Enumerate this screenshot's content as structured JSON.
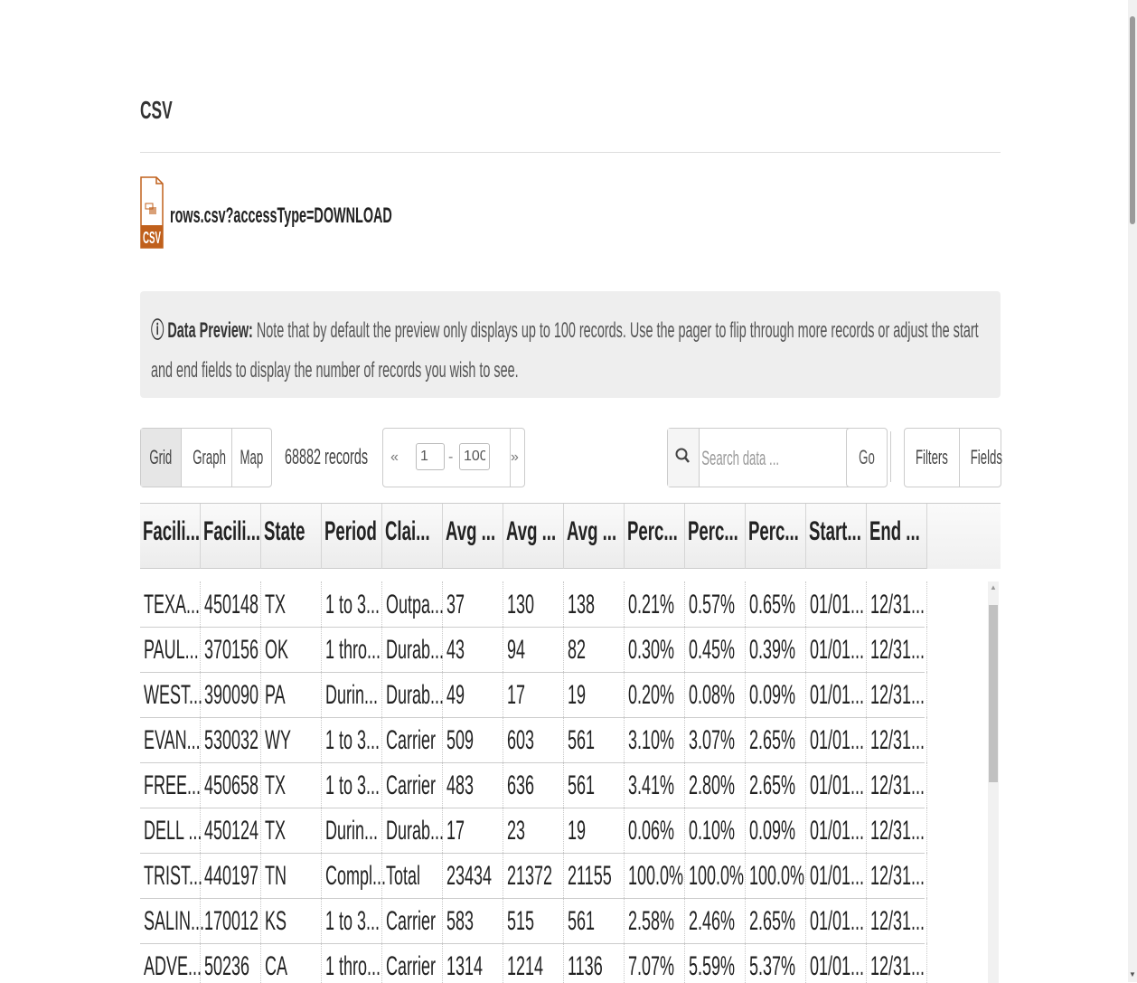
{
  "section_title": "CSV",
  "file": {
    "icon_label": "CSV",
    "name": "rows.csv?accessType=DOWNLOAD"
  },
  "notice": {
    "label": "Data Preview:",
    "text": "Note that by default the preview only displays up to 100 records. Use the pager to flip through more records or adjust the start and end fields to display the number of records you wish to see."
  },
  "toolbar": {
    "view_tabs": [
      "Grid",
      "Graph",
      "Map"
    ],
    "records": "68882 records",
    "pager": {
      "prev": "«",
      "next": "»",
      "start": "1",
      "separator": "-",
      "end": "100"
    },
    "search_placeholder": "Search data ...",
    "go_label": "Go »",
    "filters_label": "Filters",
    "fields_label": "Fields"
  },
  "grid": {
    "columns": [
      "Facili...",
      "Facili...",
      "State",
      "Period",
      "Clai...",
      "Avg ...",
      "Avg ...",
      "Avg ...",
      "Perc...",
      "Perc...",
      "Perc...",
      "Start...",
      "End ..."
    ],
    "rows": [
      [
        "TEXA...",
        "450148",
        "TX",
        "1 to 3...",
        "Outpa...",
        "37",
        "130",
        "138",
        "0.21%",
        "0.57%",
        "0.65%",
        "01/01...",
        "12/31..."
      ],
      [
        "PAUL...",
        "370156",
        "OK",
        "1 thro...",
        "Durab...",
        "43",
        "94",
        "82",
        "0.30%",
        "0.45%",
        "0.39%",
        "01/01...",
        "12/31..."
      ],
      [
        "WEST...",
        "390090",
        "PA",
        "Durin...",
        "Durab...",
        "49",
        "17",
        "19",
        "0.20%",
        "0.08%",
        "0.09%",
        "01/01...",
        "12/31..."
      ],
      [
        "EVAN...",
        "530032",
        "WY",
        "1 to 3...",
        "Carrier",
        "509",
        "603",
        "561",
        "3.10%",
        "3.07%",
        "2.65%",
        "01/01...",
        "12/31..."
      ],
      [
        "FREE...",
        "450658",
        "TX",
        "1 to 3...",
        "Carrier",
        "483",
        "636",
        "561",
        "3.41%",
        "2.80%",
        "2.65%",
        "01/01...",
        "12/31..."
      ],
      [
        "DELL ...",
        "450124",
        "TX",
        "Durin...",
        "Durab...",
        "17",
        "23",
        "19",
        "0.06%",
        "0.10%",
        "0.09%",
        "01/01...",
        "12/31..."
      ],
      [
        "TRIST...",
        "440197",
        "TN",
        "Compl...",
        "Total",
        "23434",
        "21372",
        "21155",
        "100.0%",
        "100.0%",
        "100.0%",
        "01/01...",
        "12/31..."
      ],
      [
        "SALIN...",
        "170012",
        "KS",
        "1 to 3...",
        "Carrier",
        "583",
        "515",
        "561",
        "2.58%",
        "2.46%",
        "2.65%",
        "01/01...",
        "12/31..."
      ],
      [
        "ADVE...",
        "50236",
        "CA",
        "1 thro...",
        "Carrier",
        "1314",
        "1214",
        "1136",
        "7.07%",
        "5.59%",
        "5.37%",
        "01/01...",
        "12/31..."
      ]
    ]
  },
  "colors": {
    "file_icon": "#c0601c",
    "notice_bg": "#eeeeee",
    "header_bg": "#f0f0f0"
  }
}
